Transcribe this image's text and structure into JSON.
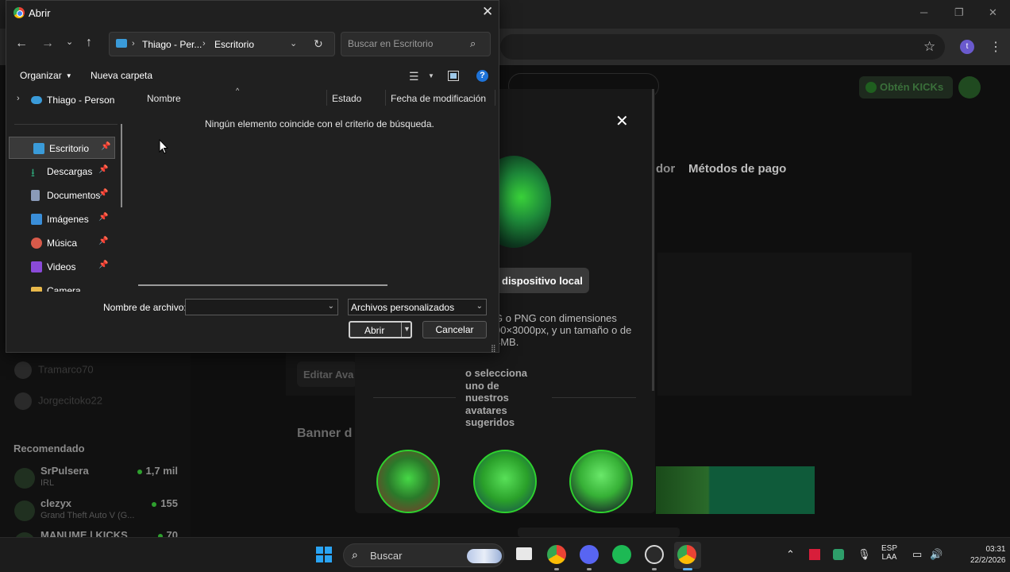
{
  "dialog": {
    "title": "Abrir",
    "address": {
      "crumb_user": "Thiago - Per...",
      "crumb_folder": "Escritorio"
    },
    "search_placeholder": "Buscar en Escritorio",
    "commands": {
      "organize": "Organizar",
      "new_folder": "Nueva carpeta"
    },
    "nav": {
      "onedrive": "Thiago - Person",
      "items": [
        {
          "label": "Escritorio",
          "icon": "desktop-icon",
          "color": "#3a9bd9"
        },
        {
          "label": "Descargas",
          "icon": "download-icon",
          "color": "#2ea87a"
        },
        {
          "label": "Documentos",
          "icon": "document-icon",
          "color": "#8a9ab8"
        },
        {
          "label": "Imágenes",
          "icon": "image-icon",
          "color": "#3a8ed8"
        },
        {
          "label": "Música",
          "icon": "music-icon",
          "color": "#d85a4a"
        },
        {
          "label": "Videos",
          "icon": "video-icon",
          "color": "#8a4ad8"
        },
        {
          "label": "Camera",
          "icon": "folder-icon",
          "color": "#e8b84a"
        }
      ]
    },
    "columns": [
      "Nombre",
      "Estado",
      "Fecha de modificación"
    ],
    "empty_message": "Ningún elemento coincide con el criterio de búsqueda.",
    "filename_label": "Nombre de archivo:",
    "filename_value": "",
    "file_type": "Archivos personalizados",
    "open_label": "Abrir",
    "cancel_label": "Cancelar"
  },
  "site": {
    "kicks_label": "Obtén KICKs",
    "tab_partial": "dor",
    "tab_payment": "Métodos de pago",
    "edit_avatar": "Editar Ava",
    "banner_title": "Banner d",
    "sidebar_users": [
      "Tramarco70",
      "Jorgecitoko22"
    ],
    "recommended_title": "Recomendado",
    "recommended": [
      {
        "name": "SrPulsera",
        "category": "IRL",
        "viewers": "1,7 mil"
      },
      {
        "name": "clezyx",
        "category": "Grand Theft Auto V (G...",
        "viewers": "155"
      },
      {
        "name": "MANUME | KICKS",
        "category": "",
        "viewers": "70"
      }
    ],
    "modal": {
      "local_button": "dispositivo local",
      "description": "G o PNG con dimensiones 00×3000px, y un tamaño o de 4MB.",
      "or_text": "o selecciona uno de nuestros avatares sugeridos"
    }
  },
  "taskbar": {
    "search_label": "Buscar",
    "language": "ESP",
    "layout": "LAA",
    "time": "03:31",
    "date": "22/2/2026"
  },
  "accent": "#2ed22e"
}
